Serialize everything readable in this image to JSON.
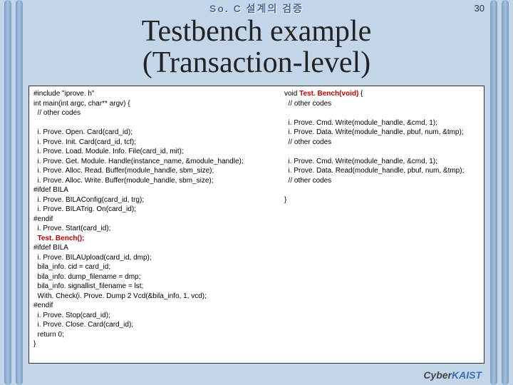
{
  "page_number": "30",
  "header_top": "So. C  설계의  검증",
  "title_line1": "Testbench example",
  "title_line2": "(Transaction-level)",
  "code_left": {
    "l01": "#include \"iprove. h\"",
    "l02": "int main(int argc, char** argv) {",
    "l03": "  // other codes",
    "l04": "",
    "l05": "  i. Prove. Open. Card(card_id);",
    "l06": "  i. Prove. Init. Card(card_id, tcf);",
    "l07": "  i. Prove. Load. Module. Info. File(card_id, mit);",
    "l08": "  i. Prove. Get. Module. Handle(instance_name, &module_handle);",
    "l09": "  i. Prove. Alloc. Read. Buffer(module_handle, sbm_size);",
    "l10": "  i. Prove. Alloc. Write. Buffer(module_handle, sbm_size);",
    "l11": "#ifdef BILA",
    "l12": "  i. Prove. BILAConfig(card_id, trg);",
    "l13": "  i. Prove. BILATrig. On(card_id);",
    "l14": "#endif",
    "l15": "  i. Prove. Start(card_id);",
    "l16_red": "  Test. Bench();",
    "l17": "#ifdef BILA",
    "l18": "  i. Prove. BILAUpload(card_id, dmp);",
    "l19": "  bila_info. cid = card_id;",
    "l20": "  bila_info. dump_filename = dmp;",
    "l21": "  bila_info. signallist_filename = lst;",
    "l22": "  With. Check(i. Prove. Dump 2 Vcd(&bila_info, 1, vcd);",
    "l23": "#endif",
    "l24": "  i. Prove. Stop(card_id);",
    "l25": "  i. Prove. Close. Card(card_id);",
    "l26": "  return 0;",
    "l27": "}"
  },
  "code_right": {
    "r01a": "void ",
    "r01b_red": "Test. Bench(void)",
    "r01c": " {",
    "r02": "  // other codes",
    "r03": "",
    "r04": "  i. Prove. Cmd. Write(module_handle, &cmd, 1);",
    "r05": "  i. Prove. Data. Write(module_handle, pbuf, num, &tmp);",
    "r06": "  // other codes",
    "r07": "",
    "r08": "  i. Prove. Cmd. Write(module_handle, &cmd, 1);",
    "r09": "  i. Prove. Data. Read(module_handle, pbuf, num, &tmp);",
    "r10": "  // other codes",
    "r11": "",
    "r12": "}"
  },
  "footer": {
    "cyber": "Cyber",
    "kaist": "KAIST"
  }
}
